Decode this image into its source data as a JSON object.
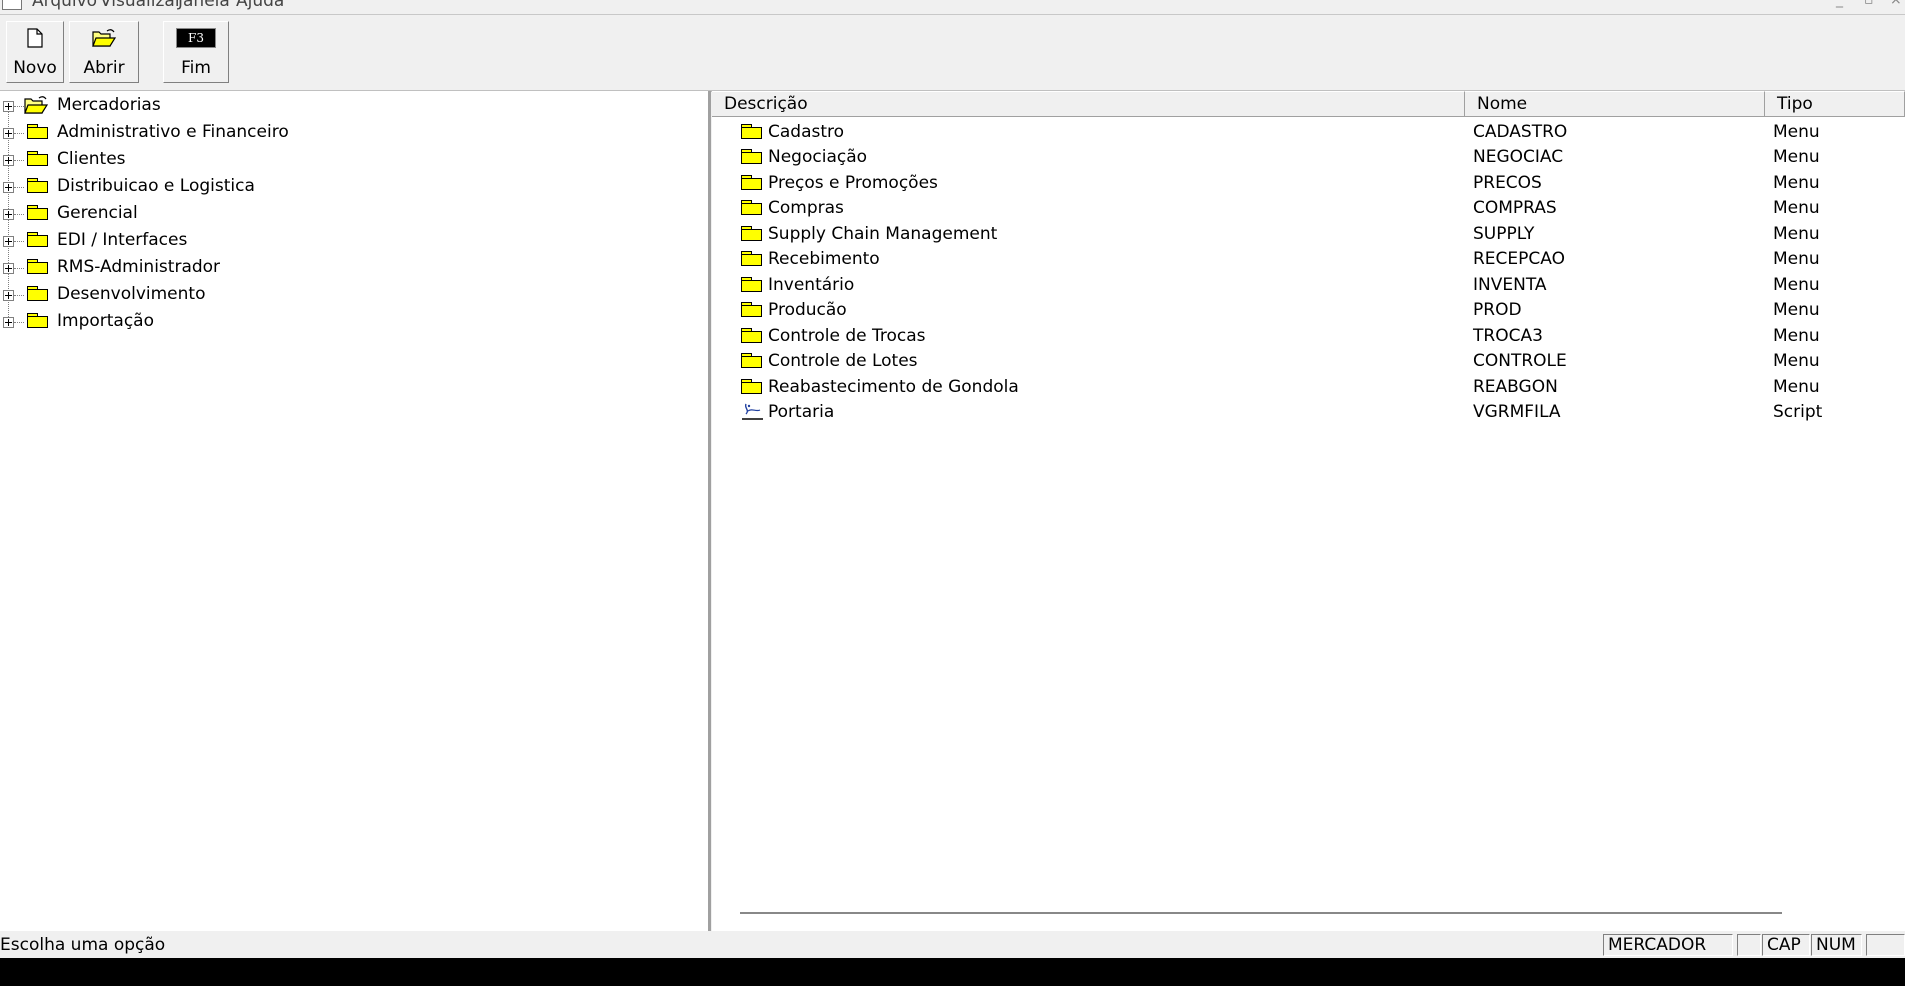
{
  "menu": [
    "Arquivo",
    "Visualizar",
    "Janela",
    "Ajuda"
  ],
  "toolbar": {
    "new_label": "Novo",
    "open_label": "Abrir",
    "exit_label": "Fim",
    "exit_key": "F3"
  },
  "tree": {
    "items": [
      {
        "label": "Mercadorias",
        "icon": "open-folder-icon"
      },
      {
        "label": "Administrativo e Financeiro",
        "icon": "folder-icon"
      },
      {
        "label": "Clientes",
        "icon": "folder-icon"
      },
      {
        "label": "Distribuicao e Logistica",
        "icon": "folder-icon"
      },
      {
        "label": "Gerencial",
        "icon": "folder-icon"
      },
      {
        "label": "EDI / Interfaces",
        "icon": "folder-icon"
      },
      {
        "label": "RMS-Administrador",
        "icon": "folder-icon"
      },
      {
        "label": "Desenvolvimento",
        "icon": "folder-icon"
      },
      {
        "label": "Importação",
        "icon": "folder-icon"
      }
    ]
  },
  "list": {
    "columns": [
      "Descrição",
      "Nome",
      "Tipo"
    ],
    "rows": [
      {
        "desc": "Cadastro",
        "nome": "CADASTRO",
        "tipo": "Menu",
        "icon": "folder-icon"
      },
      {
        "desc": "Negociação",
        "nome": "NEGOCIAC",
        "tipo": "Menu",
        "icon": "folder-icon"
      },
      {
        "desc": "Preços e Promoções",
        "nome": "PRECOS",
        "tipo": "Menu",
        "icon": "folder-icon"
      },
      {
        "desc": "Compras",
        "nome": "COMPRAS",
        "tipo": "Menu",
        "icon": "folder-icon"
      },
      {
        "desc": "Supply Chain Management",
        "nome": "SUPPLY",
        "tipo": "Menu",
        "icon": "folder-icon"
      },
      {
        "desc": "Recebimento",
        "nome": "RECEPCAO",
        "tipo": "Menu",
        "icon": "folder-icon"
      },
      {
        "desc": "Inventário",
        "nome": "INVENTA",
        "tipo": "Menu",
        "icon": "folder-icon"
      },
      {
        "desc": "Producão",
        "nome": "PROD",
        "tipo": "Menu",
        "icon": "folder-icon"
      },
      {
        "desc": "Controle de Trocas",
        "nome": "TROCA3",
        "tipo": "Menu",
        "icon": "folder-icon"
      },
      {
        "desc": "Controle de Lotes",
        "nome": "CONTROLE",
        "tipo": "Menu",
        "icon": "folder-icon"
      },
      {
        "desc": "Reabastecimento de Gondola",
        "nome": "REABGON",
        "tipo": "Menu",
        "icon": "folder-icon"
      },
      {
        "desc": "Portaria",
        "nome": "VGRMFILA",
        "tipo": "Script",
        "icon": "script-icon"
      }
    ]
  },
  "status": {
    "message": "Escolha uma opção",
    "user": "MERCADOR",
    "cap": "CAP",
    "num": "NUM"
  },
  "colors": {
    "folder": "#ffff00",
    "chrome": "#f0f0f0"
  }
}
